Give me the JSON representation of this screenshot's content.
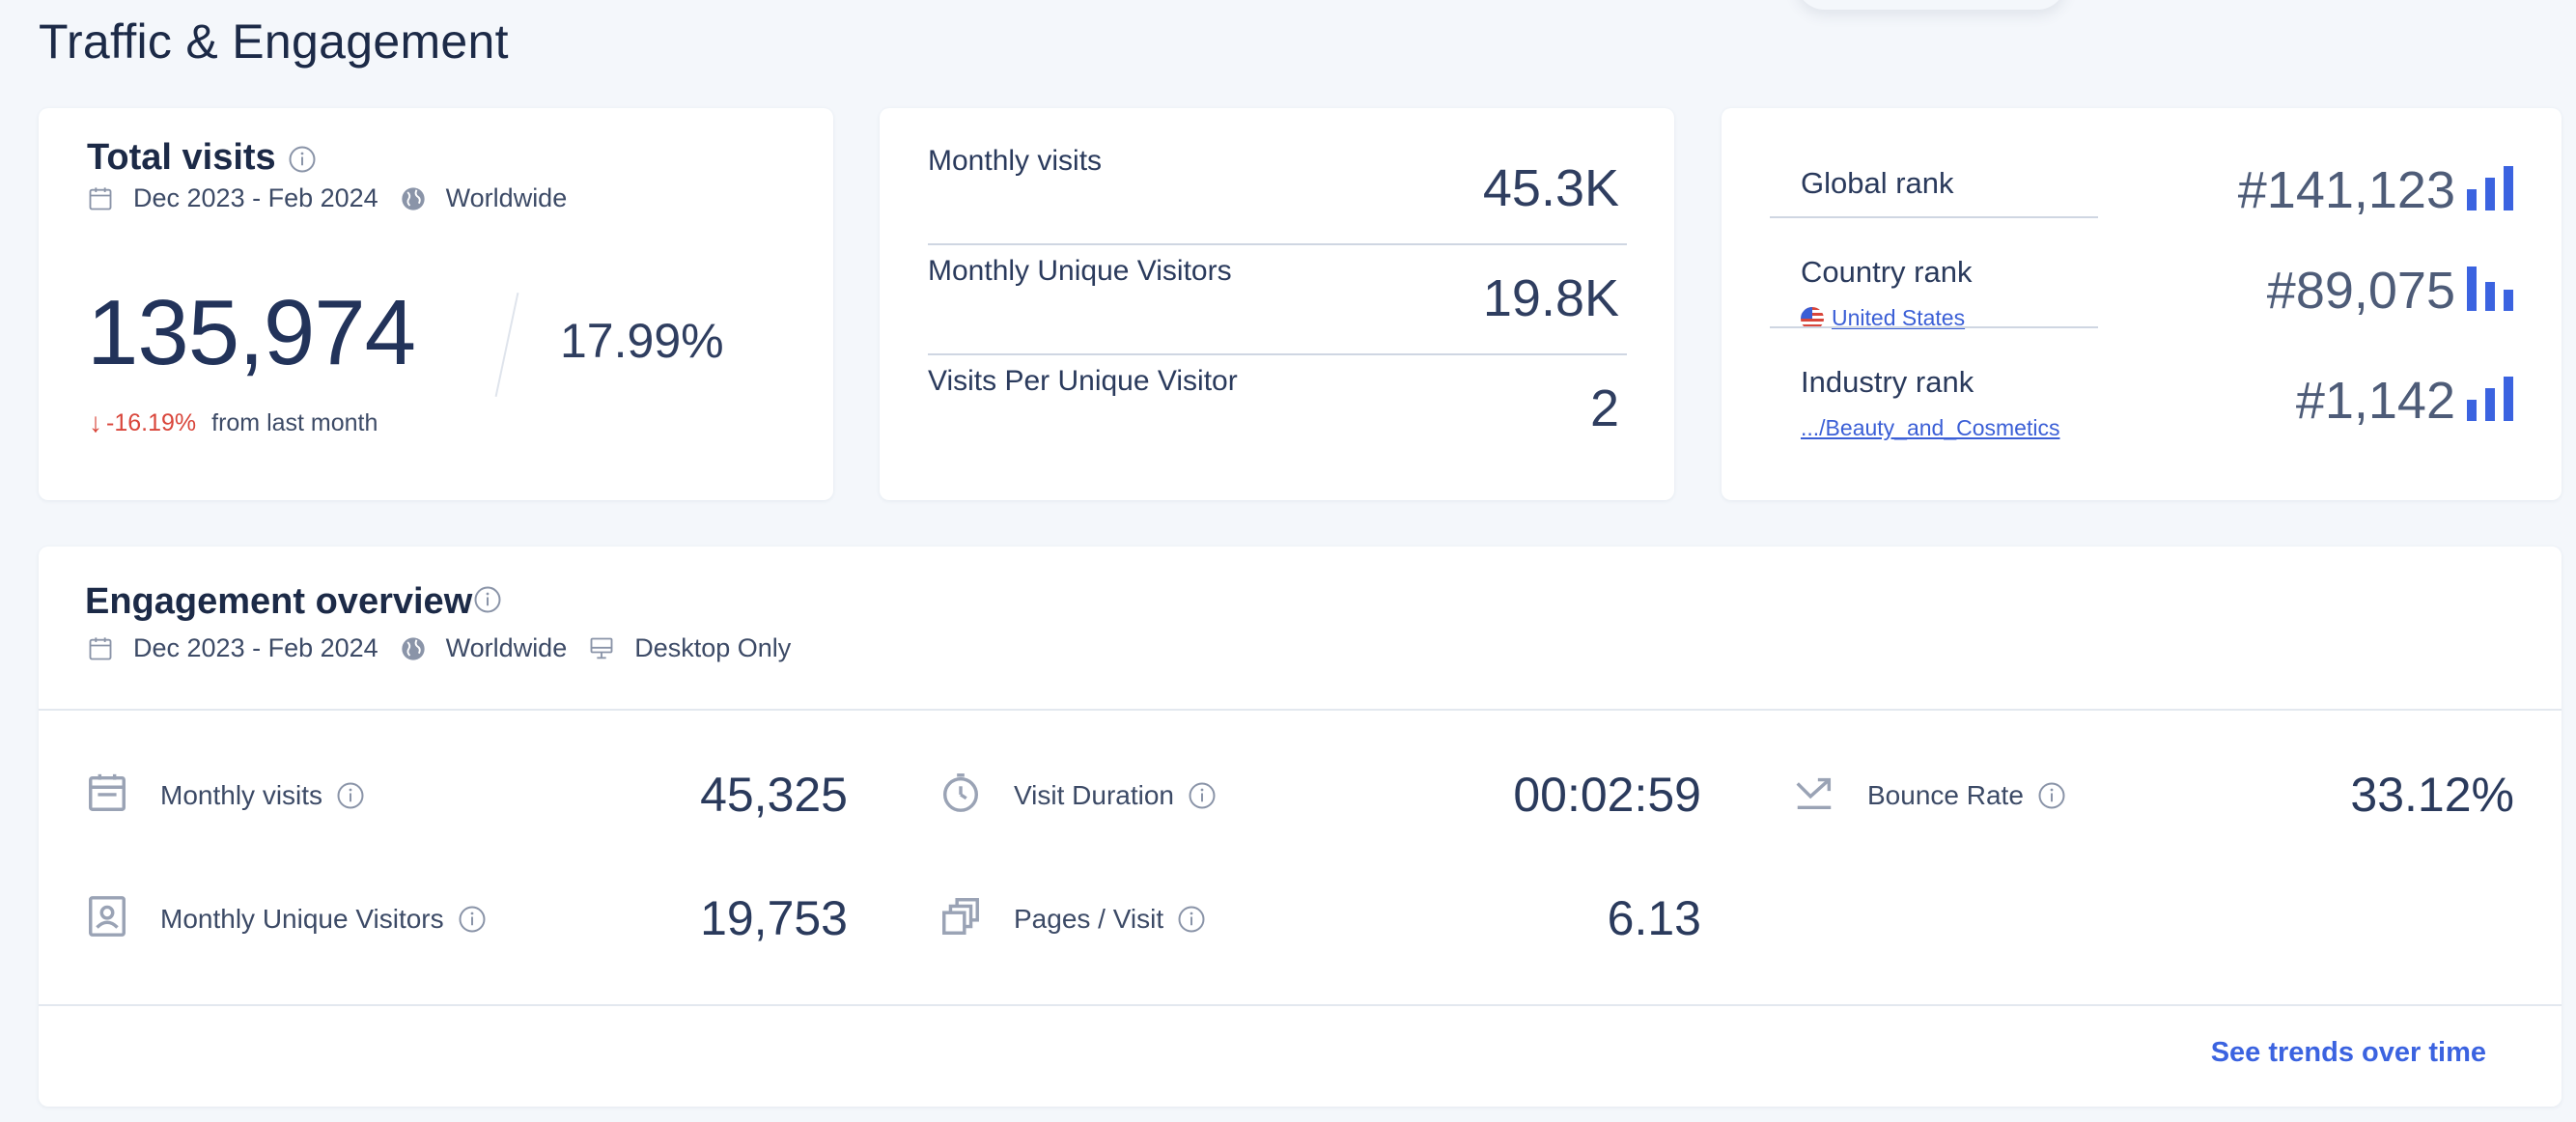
{
  "page": {
    "title": "Traffic & Engagement"
  },
  "total_visits": {
    "title": "Total visits",
    "date_range": "Dec 2023 - Feb 2024",
    "region": "Worldwide",
    "value": "135,974",
    "share": "17.99%",
    "change": "-16.19%",
    "change_text": "from last month"
  },
  "monthly_stats": [
    {
      "label": "Monthly visits",
      "value": "45.3K"
    },
    {
      "label": "Monthly Unique Visitors",
      "value": "19.8K"
    },
    {
      "label": "Visits Per Unique Visitor",
      "value": "2"
    }
  ],
  "ranks": [
    {
      "label": "Global rank",
      "value": "#141,123",
      "sub": ""
    },
    {
      "label": "Country rank",
      "value": "#89,075",
      "sub": "United States"
    },
    {
      "label": "Industry rank",
      "value": "#1,142",
      "sub": ".../Beauty_and_Cosmetics"
    }
  ],
  "engagement": {
    "title": "Engagement overview",
    "date_range": "Dec 2023 - Feb 2024",
    "region": "Worldwide",
    "device": "Desktop Only",
    "metrics": [
      {
        "label": "Monthly visits",
        "value": "45,325",
        "icon": "calendar-icon"
      },
      {
        "label": "Visit Duration",
        "value": "00:02:59",
        "icon": "stopwatch-icon"
      },
      {
        "label": "Bounce Rate",
        "value": "33.12%",
        "icon": "bounce-arrow-icon"
      },
      {
        "label": "Monthly Unique Visitors",
        "value": "19,753",
        "icon": "person-badge-icon"
      },
      {
        "label": "Pages / Visit",
        "value": "6.13",
        "icon": "pages-stack-icon"
      }
    ],
    "see_trends": "See trends over time"
  },
  "colors": {
    "accent": "#3b63e0",
    "negative": "#d9463b",
    "text_dark": "#1c2a47"
  }
}
